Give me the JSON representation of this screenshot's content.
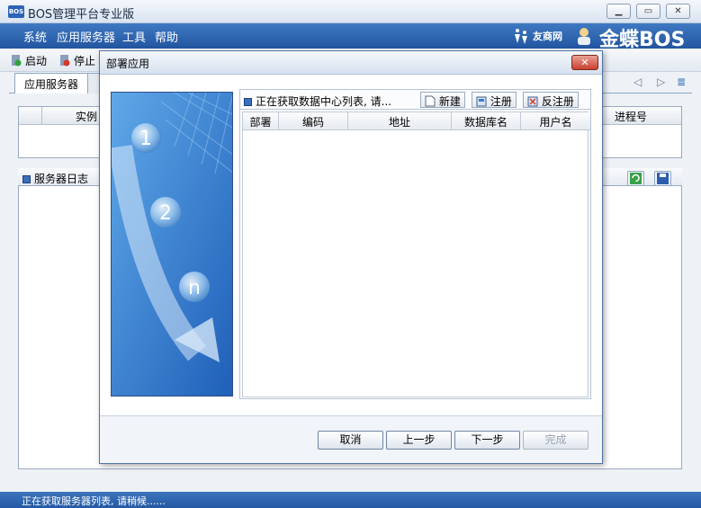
{
  "app": {
    "icon_text": "BOS",
    "title": "BOS管理平台专业版",
    "window_controls": [
      "minimize",
      "restore",
      "close"
    ]
  },
  "menu": {
    "items": [
      "系统",
      "应用服务器",
      "工具",
      "帮助"
    ],
    "brand_small": "友商网",
    "brand_main": "金蝶BOS"
  },
  "toolbar": {
    "start_label": "启动",
    "stop_label": "停止"
  },
  "tabs": {
    "active_label": "应用服务器",
    "second_label": "..."
  },
  "server_grid": {
    "columns": {
      "instance": "实例",
      "pid": "进程号"
    }
  },
  "log_panel": {
    "title": "服务器日志"
  },
  "dialog": {
    "title": "部署应用",
    "close_symbol": "✕",
    "wizard_steps": [
      "1",
      "2",
      "n"
    ],
    "loading_text": "正在获取数据中心列表, 请...",
    "actions": {
      "new": "新建",
      "register": "注册",
      "unregister": "反注册"
    },
    "columns": [
      "部署",
      "编码",
      "地址",
      "数据库名",
      "用户名"
    ],
    "buttons": {
      "cancel": "取消",
      "prev": "上一步",
      "next": "下一步",
      "finish": "完成"
    }
  },
  "status": {
    "text": "正在获取服务器列表, 请稍候......"
  }
}
